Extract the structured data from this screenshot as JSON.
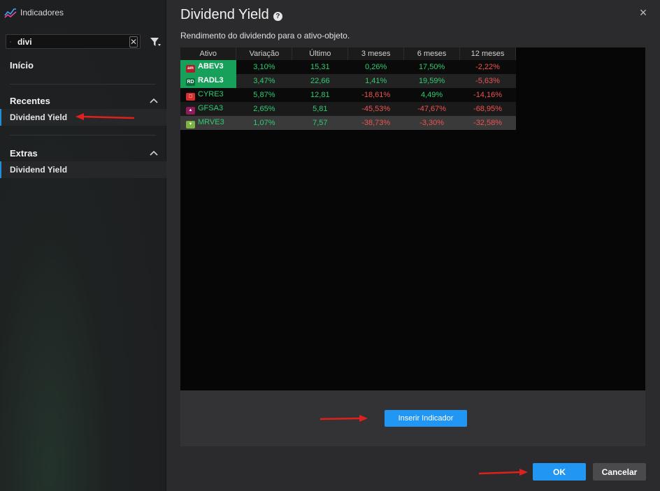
{
  "sidebar": {
    "app_title": "Indicadores",
    "search": {
      "value": "divi",
      "placeholder": ""
    },
    "home_label": "Início",
    "sections": [
      {
        "title": "Recentes",
        "items": [
          "Dividend Yield"
        ]
      },
      {
        "title": "Extras",
        "items": [
          "Dividend Yield"
        ]
      }
    ]
  },
  "dialog": {
    "title": "Dividend Yield",
    "subtitle": "Rendimento do dividendo para o ativo-objeto.",
    "help_symbol": "?",
    "close_symbol": "×"
  },
  "table": {
    "headers": [
      "Ativo",
      "Variação",
      "Último",
      "3 meses",
      "6 meses",
      "12 meses"
    ],
    "rows": [
      {
        "ativo": "ABEV3",
        "variacao": "3,10%",
        "ultimo": "15,31",
        "m3": "0,26%",
        "m6": "17,50%",
        "m12": "-2,22%",
        "logo": "ambev"
      },
      {
        "ativo": "RADL3",
        "variacao": "3,47%",
        "ultimo": "22,66",
        "m3": "1,41%",
        "m6": "19,59%",
        "m12": "-5,63%",
        "logo": "RD"
      },
      {
        "ativo": "CYRE3",
        "variacao": "5,87%",
        "ultimo": "12,81",
        "m3": "-18,61%",
        "m6": "4,49%",
        "m12": "-14,16%",
        "logo": ""
      },
      {
        "ativo": "GFSA3",
        "variacao": "2,65%",
        "ultimo": "5,81",
        "m3": "-45,53%",
        "m6": "-47,67%",
        "m12": "-68,95%",
        "logo": ""
      },
      {
        "ativo": "MRVE3",
        "variacao": "1,07%",
        "ultimo": "7,57",
        "m3": "-38,73%",
        "m6": "-3,30%",
        "m12": "-32,58%",
        "logo": ""
      }
    ]
  },
  "buttons": {
    "insert": "Inserir Indicador",
    "ok": "OK",
    "cancel": "Cancelar"
  },
  "colors": {
    "accent": "#2196f3",
    "positive": "#2ecc71",
    "negative": "#ef5350",
    "selected_asset": "#16a05a",
    "annotation_arrow": "#e0201e"
  }
}
